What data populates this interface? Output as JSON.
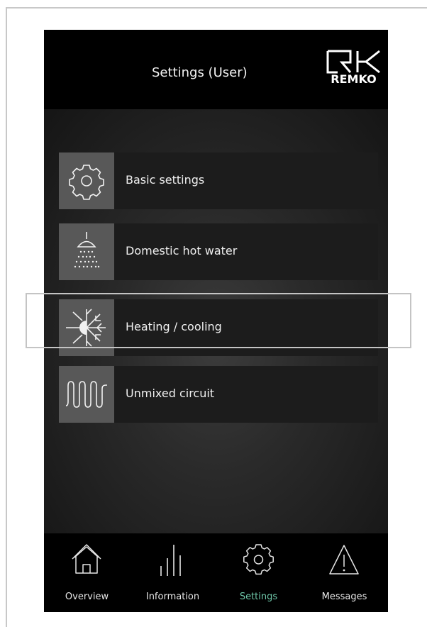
{
  "header": {
    "title": "Settings (User)",
    "logo_text": "REMKO"
  },
  "menu": {
    "items": [
      {
        "label": "Basic settings",
        "icon": "gear-icon"
      },
      {
        "label": "Domestic hot water",
        "icon": "shower-icon"
      },
      {
        "label": "Heating / cooling",
        "icon": "sun-snowflake-icon"
      },
      {
        "label": "Unmixed circuit",
        "icon": "heating-coil-icon"
      }
    ]
  },
  "tabs": [
    {
      "label": "Overview",
      "icon": "home-icon",
      "active": false
    },
    {
      "label": "Information",
      "icon": "bars-icon",
      "active": false
    },
    {
      "label": "Settings",
      "icon": "gear-icon",
      "active": true
    },
    {
      "label": "Messages",
      "icon": "warning-icon",
      "active": false
    }
  ],
  "colors": {
    "background": "#000000",
    "tile": "#1c1c1c",
    "icon_box": "#585858",
    "active_tab": "#6ec6a8",
    "highlight_border": "#c4c4c4"
  }
}
